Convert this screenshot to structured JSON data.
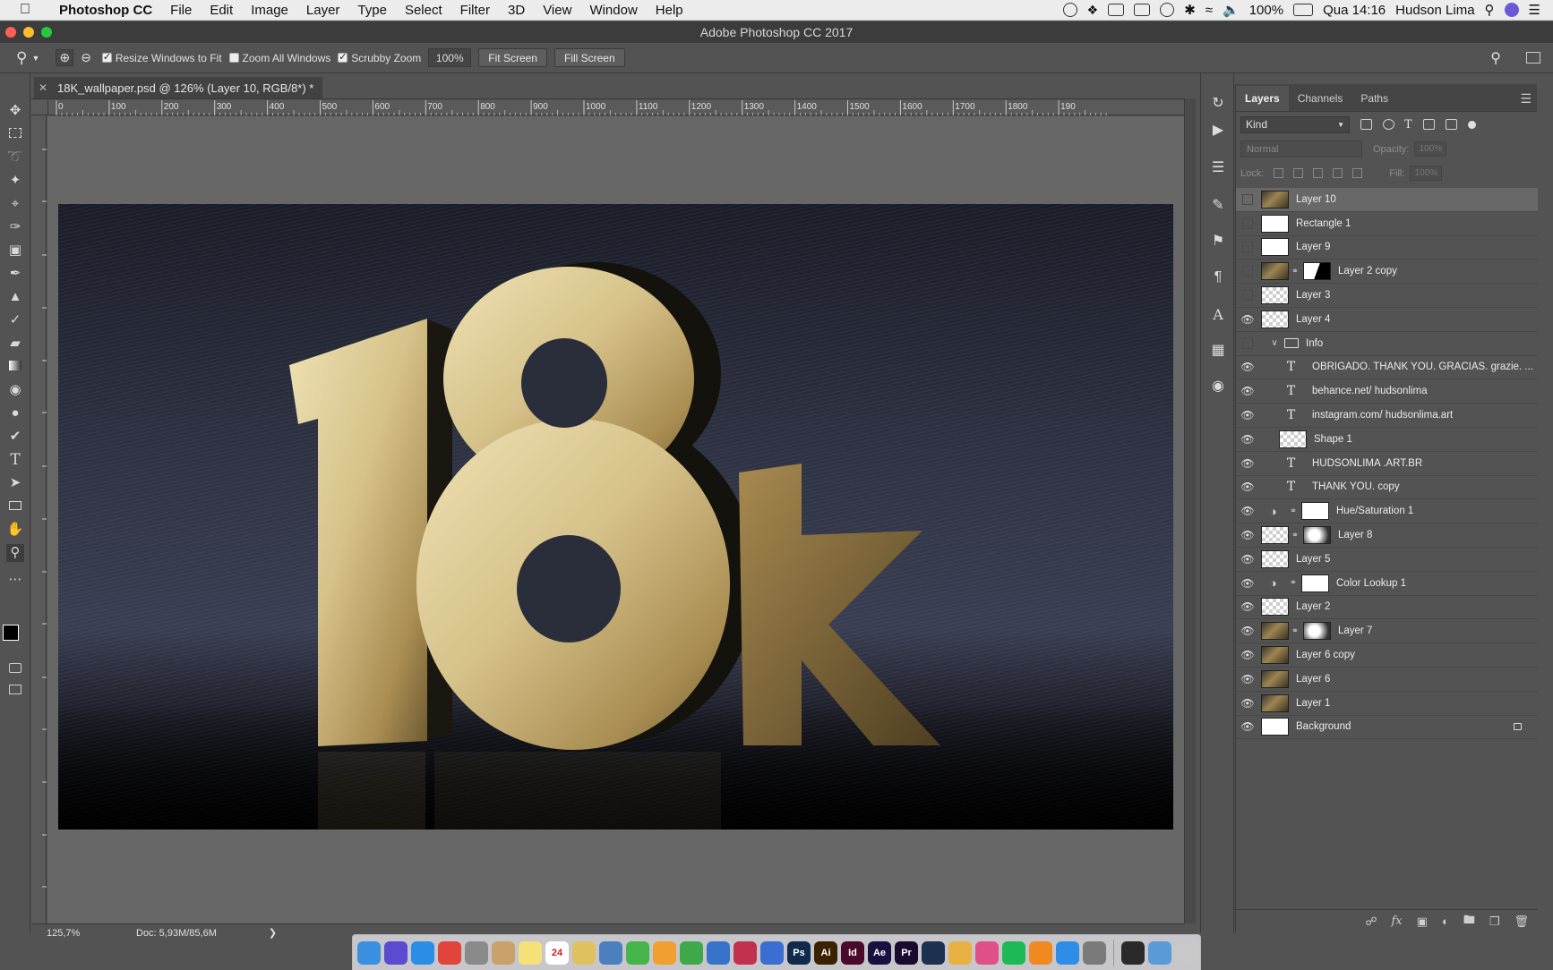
{
  "menubar": {
    "app_name": "Photoshop CC",
    "menus": [
      "File",
      "Edit",
      "Image",
      "Layer",
      "Type",
      "Select",
      "Filter",
      "3D",
      "View",
      "Window",
      "Help"
    ],
    "battery": "100%",
    "clock": "Qua 14:16",
    "user": "Hudson Lima"
  },
  "window": {
    "title": "Adobe Photoshop CC 2017"
  },
  "options": {
    "resize_windows": "Resize Windows to Fit",
    "zoom_all": "Zoom All Windows",
    "scrubby": "Scrubby Zoom",
    "zoom_value": "100%",
    "fit_screen": "Fit Screen",
    "fill_screen": "Fill Screen"
  },
  "document": {
    "tab_title": "18K_wallpaper.psd @ 126% (Layer 10, RGB/8*) *",
    "zoom": "125,7%",
    "doc_size": "Doc: 5,93M/85,6M"
  },
  "ruler": {
    "h_ticks": [
      "0",
      "100",
      "200",
      "300",
      "400",
      "500",
      "600",
      "700",
      "800",
      "900",
      "1000",
      "1100",
      "1200",
      "1300",
      "1400",
      "1500",
      "1600",
      "1700",
      "1800",
      "190"
    ]
  },
  "artwork": {
    "numeral": "18",
    "letter": "k"
  },
  "panel": {
    "tabs": [
      "Layers",
      "Channels",
      "Paths"
    ],
    "kind_filter": "Kind",
    "blend_mode": "Normal",
    "opacity_label": "Opacity:",
    "opacity_value": "100%",
    "lock_label": "Lock:",
    "fill_label": "Fill:",
    "fill_value": "100%",
    "layers": [
      {
        "name": "Layer 10",
        "thumb": "gold",
        "visible": false,
        "selected": true
      },
      {
        "name": "Rectangle 1",
        "thumb": "white",
        "visible": false
      },
      {
        "name": "Layer 9",
        "thumb": "white",
        "visible": false
      },
      {
        "name": "Layer 2 copy",
        "thumb": "gold",
        "mask": "maskbw",
        "visible": false
      },
      {
        "name": "Layer 3",
        "thumb": "checker",
        "visible": false
      },
      {
        "name": "Layer 4",
        "thumb": "checker",
        "visible": true
      },
      {
        "name": "Info",
        "type": "group",
        "visible": false
      },
      {
        "name": "OBRIGADO. THANK YOU. GRACIAS. grazie. ...",
        "type": "text",
        "indent": true,
        "visible": true
      },
      {
        "name": "behance.net/ hudsonlima",
        "type": "text",
        "indent": true,
        "visible": true
      },
      {
        "name": "instagram.com/ hudsonlima.art",
        "type": "text",
        "indent": true,
        "visible": true
      },
      {
        "name": "Shape 1",
        "thumb": "checker",
        "indent": true,
        "visible": true
      },
      {
        "name": "HUDSONLIMA .ART.BR",
        "type": "text",
        "indent": true,
        "visible": true
      },
      {
        "name": "THANK YOU.  copy",
        "type": "text",
        "indent": true,
        "visible": true
      },
      {
        "name": "Hue/Saturation 1",
        "type": "adjust",
        "mask": "white",
        "visible": true
      },
      {
        "name": "Layer 8",
        "thumb": "checker",
        "mask": "mask",
        "visible": true
      },
      {
        "name": "Layer 5",
        "thumb": "checker",
        "visible": true
      },
      {
        "name": "Color Lookup 1",
        "type": "adjust",
        "mask": "white",
        "visible": true
      },
      {
        "name": "Layer 2",
        "thumb": "checker",
        "visible": true
      },
      {
        "name": "Layer 7",
        "thumb": "gold",
        "mask": "mask",
        "visible": true
      },
      {
        "name": "Layer 6 copy",
        "thumb": "gold",
        "visible": true
      },
      {
        "name": "Layer 6",
        "thumb": "gold",
        "visible": true
      },
      {
        "name": "Layer 1",
        "thumb": "gold",
        "visible": true
      },
      {
        "name": "Background",
        "thumb": "white",
        "visible": true,
        "locked": true
      }
    ],
    "footer_icons": [
      "link-icon",
      "fx-icon",
      "mask-icon",
      "adjustment-icon",
      "folder-icon",
      "new-layer-icon",
      "trash-icon"
    ]
  },
  "dock": {
    "apps": [
      {
        "name": "finder",
        "color": "#3b8fe0",
        "label": ""
      },
      {
        "name": "siri",
        "color": "#5b4bd0",
        "label": ""
      },
      {
        "name": "safari",
        "color": "#2a8de6",
        "label": ""
      },
      {
        "name": "chrome",
        "color": "#e0443a",
        "label": ""
      },
      {
        "name": "launchpad",
        "color": "#8a8a8a",
        "label": ""
      },
      {
        "name": "contacts",
        "color": "#c8a26a",
        "label": ""
      },
      {
        "name": "notes",
        "color": "#f5e07a",
        "label": ""
      },
      {
        "name": "calendar",
        "color": "#ffffff",
        "label": "24"
      },
      {
        "name": "photos",
        "color": "#e0c060",
        "label": ""
      },
      {
        "name": "preview",
        "color": "#4a7fc0",
        "label": ""
      },
      {
        "name": "messages",
        "color": "#45b54b",
        "label": ""
      },
      {
        "name": "pages",
        "color": "#f0a030",
        "label": ""
      },
      {
        "name": "numbers",
        "color": "#3fa84a",
        "label": ""
      },
      {
        "name": "keynote",
        "color": "#3673c9",
        "label": ""
      },
      {
        "name": "app-red",
        "color": "#c23050",
        "label": ""
      },
      {
        "name": "affinity",
        "color": "#3a6ed0",
        "label": ""
      },
      {
        "name": "photoshop",
        "color": "#0f2a4a",
        "label": "Ps"
      },
      {
        "name": "illustrator",
        "color": "#3a2200",
        "label": "Ai"
      },
      {
        "name": "indesign",
        "color": "#4a0a2a",
        "label": "Id"
      },
      {
        "name": "after-effects",
        "color": "#1a1040",
        "label": "Ae"
      },
      {
        "name": "premiere",
        "color": "#1a0a30",
        "label": "Pr"
      },
      {
        "name": "cinema4d",
        "color": "#1d3050",
        "label": ""
      },
      {
        "name": "pencil",
        "color": "#e8b040",
        "label": ""
      },
      {
        "name": "itunes",
        "color": "#e05088",
        "label": ""
      },
      {
        "name": "spotify",
        "color": "#1db954",
        "label": ""
      },
      {
        "name": "books",
        "color": "#f08a20",
        "label": ""
      },
      {
        "name": "app-store",
        "color": "#2f8de8",
        "label": ""
      },
      {
        "name": "system-prefs",
        "color": "#7a7a7a",
        "label": ""
      },
      {
        "name": "terminal",
        "color": "#2a2a2a",
        "label": ""
      },
      {
        "name": "downloads",
        "color": "#5a9ad8",
        "label": ""
      },
      {
        "name": "trash",
        "color": "#c8c8c8",
        "label": ""
      }
    ]
  }
}
